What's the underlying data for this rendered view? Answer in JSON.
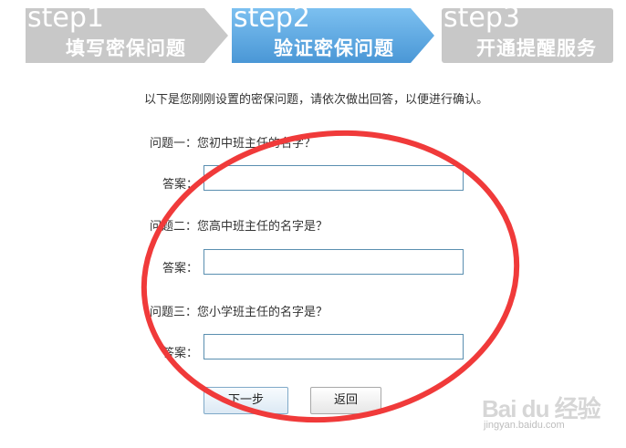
{
  "steps": [
    {
      "num": "step1",
      "title": "填写密保问题",
      "state": "done",
      "color": "#c9c9c9"
    },
    {
      "num": "step2",
      "title": "验证密保问题",
      "state": "active",
      "color": "#5fa8e0"
    },
    {
      "num": "step3",
      "title": "开通提醒服务",
      "state": "pending",
      "color": "#c9c9c9"
    }
  ],
  "intro": "以下是您刚刚设置的密保问题，请依次做出回答，以便进行确认。",
  "questions": [
    {
      "label": "问题一：",
      "text": "您初中班主任的名字？",
      "answer_label": "答案：",
      "answer_value": ""
    },
    {
      "label": "问题二：",
      "text": "您高中班主任的名字是？",
      "answer_label": "答案：",
      "answer_value": ""
    },
    {
      "label": "问题三：",
      "text": "您小学班主任的名字是？",
      "answer_label": "答案：",
      "answer_value": ""
    }
  ],
  "buttons": {
    "next": "下一步",
    "back": "返回"
  },
  "watermark": {
    "brand": "Bai du 经验",
    "url": "jingyan.baidu.com"
  },
  "annotation_color": "#f03a3a"
}
